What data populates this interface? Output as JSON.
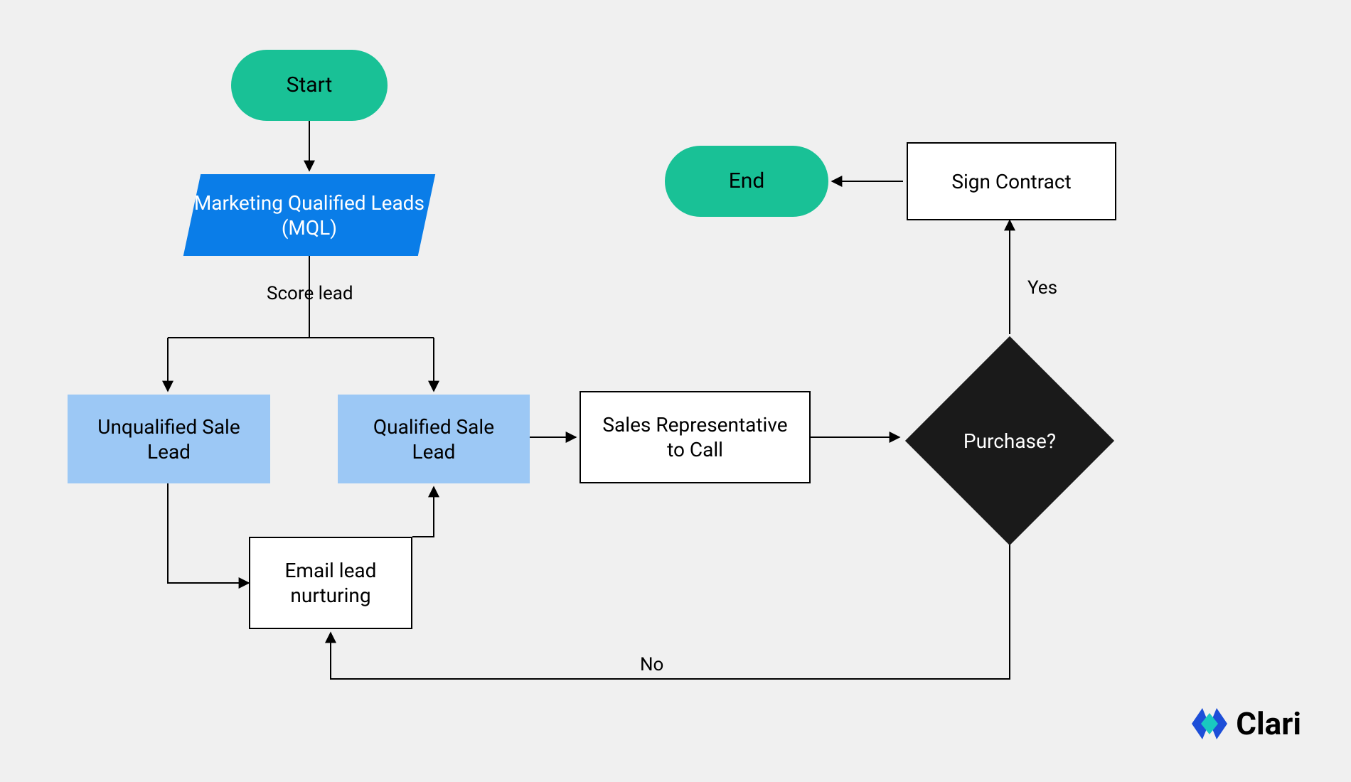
{
  "nodes": {
    "start": "Start",
    "mql": "Marketing Qualified Leads (MQL)",
    "unqualified": "Unqualified Sale Lead",
    "qualified": "Qualified Sale Lead",
    "email_nurture": "Email lead nurturing",
    "sales_rep": "Sales Representative to Call",
    "purchase": "Purchase?",
    "sign_contract": "Sign Contract",
    "end": "End"
  },
  "edges": {
    "score_lead": "Score lead",
    "yes": "Yes",
    "no": "No"
  },
  "brand": {
    "name": "Clari"
  },
  "flow": [
    {
      "from": "start",
      "to": "mql"
    },
    {
      "from": "mql",
      "to": "unqualified",
      "label": "Score lead"
    },
    {
      "from": "mql",
      "to": "qualified",
      "label": "Score lead"
    },
    {
      "from": "unqualified",
      "to": "email_nurture"
    },
    {
      "from": "email_nurture",
      "to": "qualified"
    },
    {
      "from": "qualified",
      "to": "sales_rep"
    },
    {
      "from": "sales_rep",
      "to": "purchase"
    },
    {
      "from": "purchase",
      "to": "sign_contract",
      "label": "Yes"
    },
    {
      "from": "purchase",
      "to": "email_nurture",
      "label": "No"
    },
    {
      "from": "sign_contract",
      "to": "end"
    }
  ]
}
